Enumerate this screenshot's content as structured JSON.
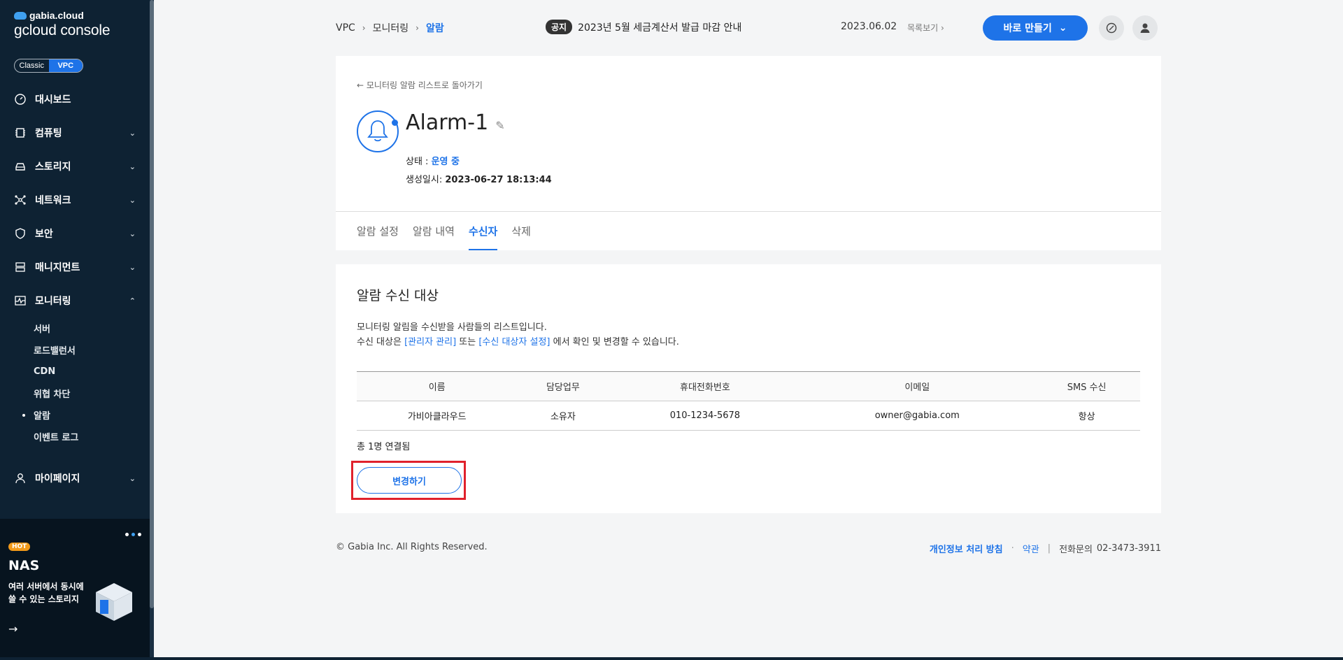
{
  "sidebar": {
    "brand_top": "gabia.cloud",
    "brand_bottom": "gcloud console",
    "toggle": {
      "classic": "Classic",
      "vpc": "VPC"
    },
    "items": [
      {
        "label": "대시보드",
        "icon": "dashboard-icon"
      },
      {
        "label": "컴퓨팅",
        "icon": "cpu-icon"
      },
      {
        "label": "스토리지",
        "icon": "storage-icon"
      },
      {
        "label": "네트워크",
        "icon": "network-icon"
      },
      {
        "label": "보안",
        "icon": "shield-icon"
      },
      {
        "label": "매니지먼트",
        "icon": "management-icon"
      },
      {
        "label": "모니터링",
        "icon": "monitoring-icon"
      }
    ],
    "sub_items": [
      "서버",
      "로드밸런서",
      "CDN",
      "위협 차단",
      "알람",
      "이벤트 로그"
    ],
    "mypage": "마이페이지",
    "promo": {
      "badge": "HOT",
      "title": "NAS",
      "desc": "여러 서버에서 동시에 쓸 수 있는 스토리지",
      "arrow": "→"
    }
  },
  "topbar": {
    "breadcrumb": [
      "VPC",
      "모니터링",
      "알람"
    ],
    "notice_tag": "공지",
    "notice_text": "2023년 5월 세금계산서 발급 마감 안내",
    "notice_date": "2023.06.02",
    "notice_list": "목록보기",
    "make_button": "바로 만들기"
  },
  "detail": {
    "back_link": "모니터링 알람 리스트로 돌아가기",
    "title": "Alarm-1",
    "status_label": "상태 : ",
    "status_value": "운영 중",
    "created_label": "생성일시: ",
    "created_value": "2023-06-27 18:13:44",
    "tabs": [
      "알람 설정",
      "알람 내역",
      "수신자",
      "삭제"
    ]
  },
  "recipients": {
    "title": "알람 수신 대상",
    "desc_line1": "모니터링 알림을 수신받을 사람들의 리스트입니다.",
    "desc_line2_a": "수신 대상은 ",
    "desc_link1": "[관리자 관리]",
    "desc_line2_b": " 또는 ",
    "desc_link2": "[수신 대상자 설정]",
    "desc_line2_c": " 에서 확인 및 변경할 수 있습니다.",
    "columns": [
      "이름",
      "담당업무",
      "휴대전화번호",
      "이메일",
      "SMS 수신"
    ],
    "rows": [
      [
        "가비아클라우드",
        "소유자",
        "010-1234-5678",
        "owner@gabia.com",
        "항상"
      ]
    ],
    "total": "총 1명 연결됨",
    "change_button": "변경하기"
  },
  "footer": {
    "copyright": "© Gabia Inc. All Rights Reserved.",
    "privacy": "개인정보 처리 방침",
    "dot": "·",
    "terms": "약관",
    "bar": "|",
    "phone_label": "전화문의",
    "phone": "02-3473-3911"
  }
}
